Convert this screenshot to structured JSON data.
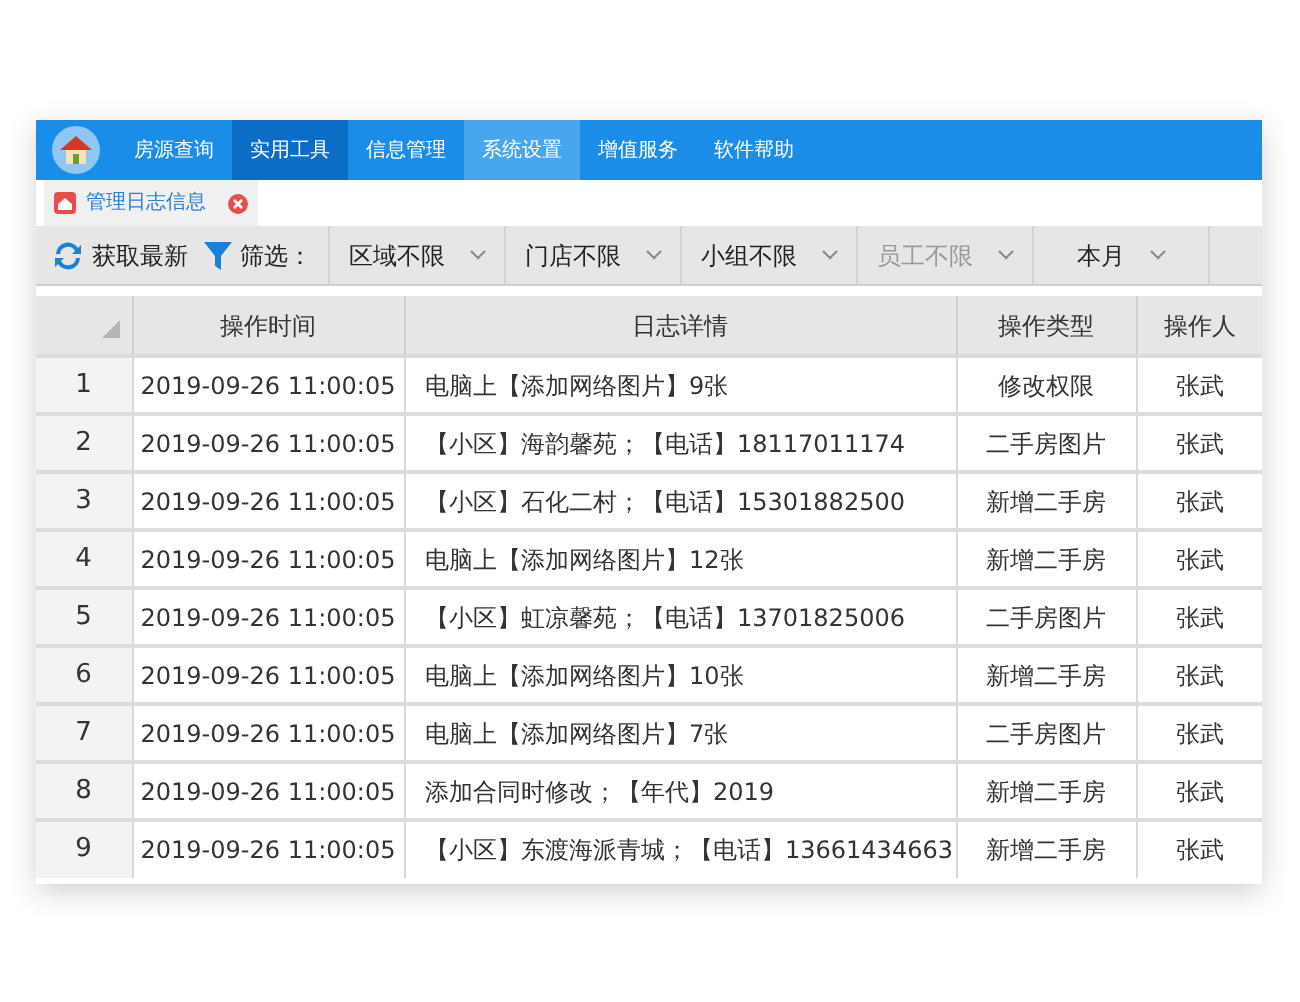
{
  "menu": {
    "items": [
      {
        "label": "房源查询",
        "selected": false,
        "highlighted": false
      },
      {
        "label": "实用工具",
        "selected": true,
        "highlighted": false
      },
      {
        "label": "信息管理",
        "selected": false,
        "highlighted": false
      },
      {
        "label": "系统设置",
        "selected": false,
        "highlighted": true
      },
      {
        "label": "增值服务",
        "selected": false,
        "highlighted": false
      },
      {
        "label": "软件帮助",
        "selected": false,
        "highlighted": false
      }
    ]
  },
  "tabs": [
    {
      "label": "管理日志信息",
      "selected": true
    }
  ],
  "toolbar": {
    "refresh": "获取最新",
    "filter_label": "筛选：",
    "filters": [
      {
        "label": "区域不限",
        "disabled": false
      },
      {
        "label": "门店不限",
        "disabled": false
      },
      {
        "label": "小组不限",
        "disabled": false
      },
      {
        "label": "员工不限",
        "disabled": true
      },
      {
        "label": "本月",
        "disabled": false
      }
    ]
  },
  "table": {
    "columns": [
      "操作时间",
      "日志详情",
      "操作类型",
      "操作人"
    ],
    "rows": [
      {
        "index": "1",
        "time": "2019-09-26 11:00:05",
        "detail": "电脑上【添加网络图片】9张",
        "type": "修改权限",
        "user": "张武"
      },
      {
        "index": "2",
        "time": "2019-09-26 11:00:05",
        "detail": "【小区】海韵馨苑；【电话】18117011174",
        "type": "二手房图片",
        "user": "张武"
      },
      {
        "index": "3",
        "time": "2019-09-26 11:00:05",
        "detail": "【小区】石化二村；【电话】15301882500",
        "type": "新增二手房",
        "user": "张武"
      },
      {
        "index": "4",
        "time": "2019-09-26 11:00:05",
        "detail": "电脑上【添加网络图片】12张",
        "type": "新增二手房",
        "user": "张武"
      },
      {
        "index": "5",
        "time": "2019-09-26 11:00:05",
        "detail": "【小区】虹凉馨苑；【电话】13701825006",
        "type": "二手房图片",
        "user": "张武"
      },
      {
        "index": "6",
        "time": "2019-09-26 11:00:05",
        "detail": "电脑上【添加网络图片】10张",
        "type": "新增二手房",
        "user": "张武"
      },
      {
        "index": "7",
        "time": "2019-09-26 11:00:05",
        "detail": "电脑上【添加网络图片】7张",
        "type": "二手房图片",
        "user": "张武"
      },
      {
        "index": "8",
        "time": "2019-09-26 11:00:05",
        "detail": "添加合同时修改；【年代】2019",
        "type": "新增二手房",
        "user": "张武"
      },
      {
        "index": "9",
        "time": "2019-09-26 11:00:05",
        "detail": "【小区】东渡海派青城；【电话】13661434663",
        "type": "新增二手房",
        "user": "张武"
      }
    ]
  }
}
